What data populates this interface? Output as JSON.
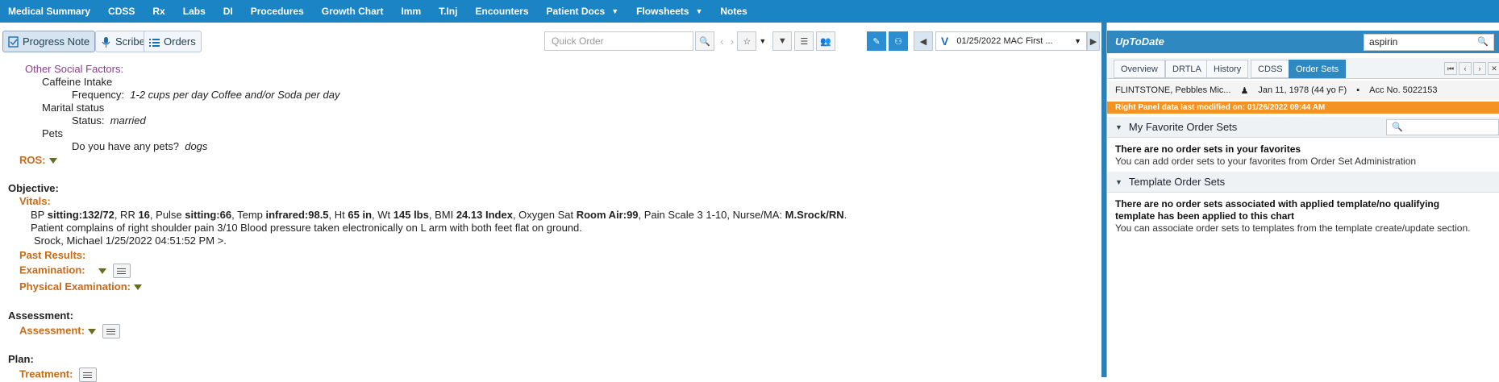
{
  "topnav": {
    "items": [
      "Medical Summary",
      "CDSS",
      "Rx",
      "Labs",
      "DI",
      "Procedures",
      "Growth Chart",
      "Imm",
      "T.Inj",
      "Encounters",
      "Patient Docs",
      "Flowsheets",
      "Notes"
    ]
  },
  "toolbar": {
    "progress_note": "Progress Note",
    "scribe": "Scribe",
    "orders": "Orders",
    "quick_order_placeholder": "Quick Order",
    "encounter_v": "V",
    "encounter": "01/25/2022 MAC First ..."
  },
  "note": {
    "other_social_factors": "Other Social Factors:",
    "caffeine": "Caffeine Intake",
    "frequency_label": "Frequency:",
    "frequency_value": "1-2 cups per day Coffee and/or Soda per day",
    "marital": "Marital status",
    "status_label": "Status:",
    "status_value": "married",
    "pets": "Pets",
    "pets_q": "Do you have any pets?",
    "pets_a": "dogs",
    "ros": "ROS:",
    "objective": "Objective:",
    "vitals": "Vitals:",
    "vitals_bp_label": "BP",
    "vitals_bp": "sitting:132/72",
    "vitals_rr_label": ", RR",
    "vitals_rr": "16",
    "vitals_pulse_label": ", Pulse",
    "vitals_pulse": "sitting:66",
    "vitals_temp_label": ", Temp",
    "vitals_temp": "infrared:98.5",
    "vitals_ht_label": ", Ht",
    "vitals_ht": "65 in",
    "vitals_wt_label": ", Wt",
    "vitals_wt": "145 lbs",
    "vitals_bmi_label": ", BMI",
    "vitals_bmi": "24.13 Index",
    "vitals_o2_label": ", Oxygen Sat",
    "vitals_o2": "Room Air:99",
    "vitals_pain_label": ", Pain Scale 3 1-10, Nurse/MA:",
    "vitals_nurse": "M.Srock/RN",
    "vitals_end": ".",
    "complaint": "Patient complains of right shoulder pain 3/10 Blood pressure taken electronically on L arm with both feet flat on ground.",
    "signature": "Srock, Michael 1/25/2022 04:51:52 PM >.",
    "past_results": "Past Results:",
    "examination": "Examination:",
    "physical_exam": "Physical Examination:",
    "assessment_head": "Assessment:",
    "assessment": "Assessment:",
    "plan": "Plan:",
    "treatment": "Treatment:"
  },
  "right": {
    "title": "UpToDate",
    "search_value": "aspirin",
    "tabs": [
      "Overview",
      "DRTLA",
      "History",
      "CDSS",
      "Order Sets"
    ],
    "patient_name": "FLINTSTONE, Pebbles Mic...",
    "patient_dob": "Jan 11, 1978 (44 yo F)",
    "patient_acc": "Acc No. 5022153",
    "modified": "Right Panel data last modified on: 01/26/2022 09:44 AM",
    "fav_header": "My Favorite Order Sets",
    "fav_empty": "There are no order sets in your favorites",
    "fav_hint": "You can add order sets to your favorites from Order Set Administration",
    "tmpl_header": "Template Order Sets",
    "tmpl_empty_1": "There are no order sets associated with applied template/no qualifying",
    "tmpl_empty_2": "template has been applied to this chart",
    "tmpl_hint": "You can associate order sets to templates from the template create/update section."
  }
}
